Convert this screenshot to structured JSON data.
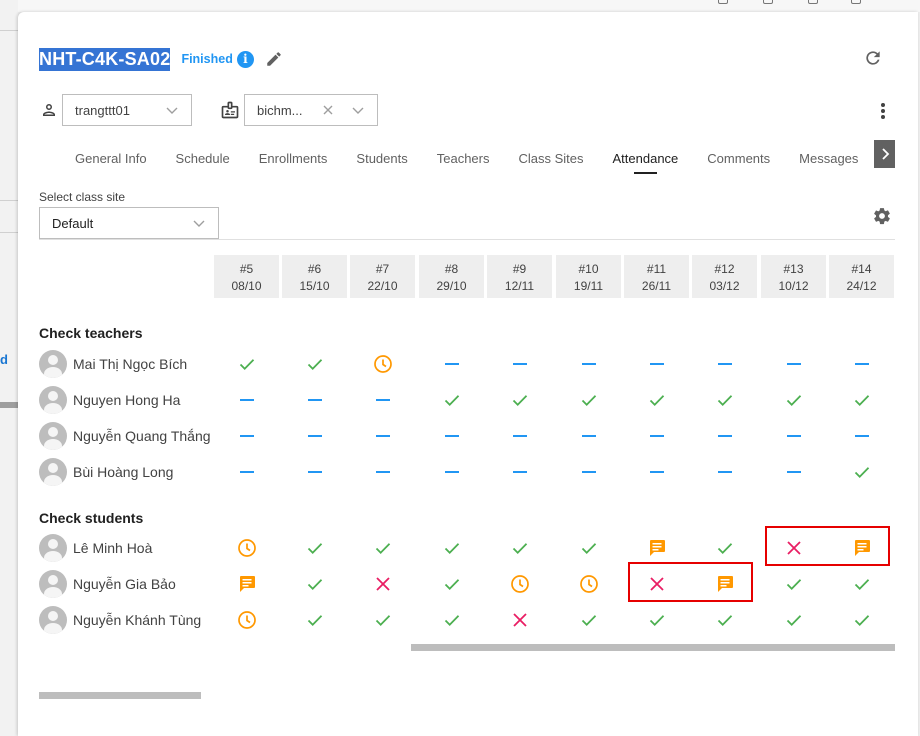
{
  "header": {
    "class_code": "NHT-C4K-SA02",
    "status": "Finished",
    "info_glyph": "i"
  },
  "people": {
    "teacher_value": "trangttt01",
    "assistant_value": "bichm..."
  },
  "tabs": [
    "General Info",
    "Schedule",
    "Enrollments",
    "Students",
    "Teachers",
    "Class Sites",
    "Attendance",
    "Comments",
    "Messages"
  ],
  "active_tab": "Attendance",
  "site": {
    "label": "Select class site",
    "value": "Default"
  },
  "sessions": [
    {
      "num": "#5",
      "date": "08/10"
    },
    {
      "num": "#6",
      "date": "15/10"
    },
    {
      "num": "#7",
      "date": "22/10"
    },
    {
      "num": "#8",
      "date": "29/10"
    },
    {
      "num": "#9",
      "date": "12/11"
    },
    {
      "num": "#10",
      "date": "19/11"
    },
    {
      "num": "#11",
      "date": "26/11"
    },
    {
      "num": "#12",
      "date": "03/12"
    },
    {
      "num": "#13",
      "date": "10/12"
    },
    {
      "num": "#14",
      "date": "24/12"
    }
  ],
  "teachers": {
    "title": "Check teachers",
    "rows": [
      {
        "name": "Mai Thị Ngọc Bích",
        "marks": [
          "check",
          "check",
          "clock",
          "dash",
          "dash",
          "dash",
          "dash",
          "dash",
          "dash",
          "dash"
        ]
      },
      {
        "name": "Nguyen Hong Ha",
        "marks": [
          "dash",
          "dash",
          "dash",
          "check",
          "check",
          "check",
          "check",
          "check",
          "check",
          "check"
        ]
      },
      {
        "name": "Nguyễn Quang Thắng",
        "marks": [
          "dash",
          "dash",
          "dash",
          "dash",
          "dash",
          "dash",
          "dash",
          "dash",
          "dash",
          "dash"
        ]
      },
      {
        "name": "Bùi Hoàng Long",
        "marks": [
          "dash",
          "dash",
          "dash",
          "dash",
          "dash",
          "dash",
          "dash",
          "dash",
          "dash",
          "check"
        ]
      }
    ]
  },
  "students": {
    "title": "Check students",
    "rows": [
      {
        "name": "Lê Minh Hoà",
        "marks": [
          "clock",
          "check",
          "check",
          "check",
          "check",
          "check",
          "comment",
          "check",
          "cross",
          "comment"
        ]
      },
      {
        "name": "Nguyễn Gia Bảo",
        "marks": [
          "comment",
          "check",
          "cross",
          "check",
          "clock",
          "clock",
          "cross",
          "comment",
          "check",
          "check"
        ]
      },
      {
        "name": "Nguyễn Khánh Tùng",
        "marks": [
          "clock",
          "check",
          "check",
          "check",
          "cross",
          "check",
          "check",
          "check",
          "check",
          "check"
        ]
      }
    ]
  },
  "highlights": [
    {
      "student": "Lê Minh Hoà",
      "sessions": [
        "#13",
        "#14"
      ]
    },
    {
      "student": "Nguyễn Gia Bảo",
      "sessions": [
        "#11",
        "#12"
      ]
    }
  ],
  "colors": {
    "check": "#4caf50",
    "dash": "#2196f3",
    "clock": "#ff9800",
    "comment": "#ff9800",
    "cross": "#e91e63",
    "highlight": "#e60000",
    "selection": "#3574d4"
  },
  "icons": {
    "check": "check-icon",
    "dash": "dash-icon",
    "clock": "clock-icon",
    "comment": "comment-icon",
    "cross": "cross-icon"
  }
}
